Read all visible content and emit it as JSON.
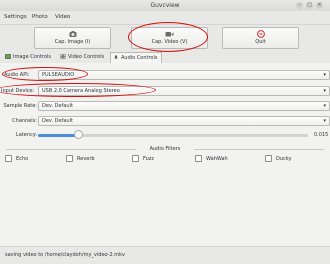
{
  "window": {
    "title": "Guvcview"
  },
  "menu": [
    "Settings",
    "Photo",
    "Video"
  ],
  "toolbar": {
    "cap_image_label": "Cap. Image (I)",
    "cap_video_label": "Cap. Video (V)",
    "quit_label": "Quit"
  },
  "tabs": [
    "Image Controls",
    "Video Controls",
    "Audio Controls"
  ],
  "audio": {
    "api_label": "Audio API:",
    "api_value": "PULSEAUDIO",
    "device_label": "Input Device:",
    "device_value": "USB 2.0 Camera Analog Stereo",
    "rate_label": "Sample Rate:",
    "rate_value": "Dev. Default",
    "channels_label": "Channels:",
    "channels_value": "Dev. Default",
    "latency_label": "Latency:",
    "latency_value": "0.015",
    "latency_fraction": 0.15
  },
  "filters": {
    "title": "Audio Filters",
    "items": [
      "Echo",
      "Reverb",
      "Fuzz",
      "WahWah",
      "Ducky"
    ]
  },
  "status": "saving video to /home/claydoh/my_video-2.mkv",
  "colors": {
    "annotation": "#d30f0f",
    "accent": "#4a90d9"
  }
}
